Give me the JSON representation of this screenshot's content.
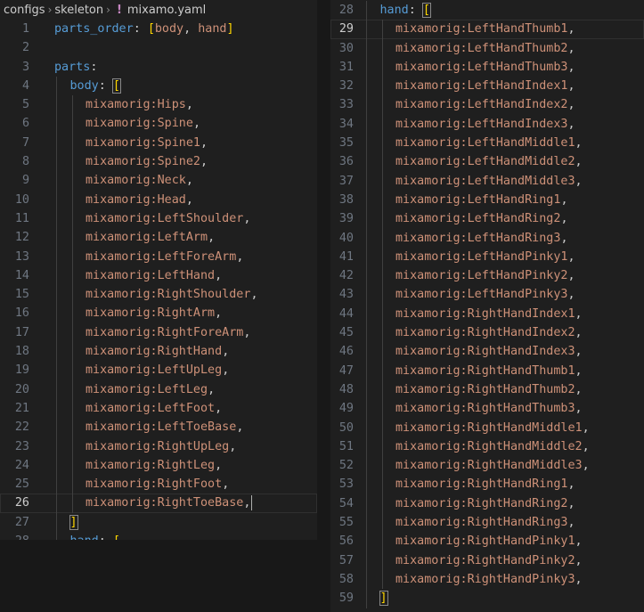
{
  "breadcrumb": {
    "folder1": "configs",
    "folder2": "skeleton",
    "file": "mixamo.yaml",
    "sep": "›",
    "file_icon": "!"
  },
  "left": {
    "active_line": "26",
    "lines": [
      {
        "n": "1",
        "ind": 0,
        "segs": [
          {
            "c": "k",
            "t": "parts_order"
          },
          {
            "c": "p",
            "t": ": "
          },
          {
            "c": "b",
            "t": "["
          },
          {
            "c": "s",
            "t": "body"
          },
          {
            "c": "p",
            "t": ", "
          },
          {
            "c": "s",
            "t": "hand"
          },
          {
            "c": "b",
            "t": "]"
          }
        ]
      },
      {
        "n": "2",
        "ind": 0,
        "segs": []
      },
      {
        "n": "3",
        "ind": 0,
        "segs": [
          {
            "c": "k",
            "t": "parts"
          },
          {
            "c": "p",
            "t": ":"
          }
        ]
      },
      {
        "n": "4",
        "ind": 1,
        "segs": [
          {
            "c": "k",
            "t": "body"
          },
          {
            "c": "p",
            "t": ": "
          },
          {
            "c": "b bb",
            "t": "["
          }
        ]
      },
      {
        "n": "5",
        "ind": 2,
        "segs": [
          {
            "c": "s",
            "t": "mixamorig:Hips"
          },
          {
            "c": "p",
            "t": ","
          }
        ]
      },
      {
        "n": "6",
        "ind": 2,
        "segs": [
          {
            "c": "s",
            "t": "mixamorig:Spine"
          },
          {
            "c": "p",
            "t": ","
          }
        ]
      },
      {
        "n": "7",
        "ind": 2,
        "segs": [
          {
            "c": "s",
            "t": "mixamorig:Spine1"
          },
          {
            "c": "p",
            "t": ","
          }
        ]
      },
      {
        "n": "8",
        "ind": 2,
        "segs": [
          {
            "c": "s",
            "t": "mixamorig:Spine2"
          },
          {
            "c": "p",
            "t": ","
          }
        ]
      },
      {
        "n": "9",
        "ind": 2,
        "segs": [
          {
            "c": "s",
            "t": "mixamorig:Neck"
          },
          {
            "c": "p",
            "t": ","
          }
        ]
      },
      {
        "n": "10",
        "ind": 2,
        "segs": [
          {
            "c": "s",
            "t": "mixamorig:Head"
          },
          {
            "c": "p",
            "t": ","
          }
        ]
      },
      {
        "n": "11",
        "ind": 2,
        "segs": [
          {
            "c": "s",
            "t": "mixamorig:LeftShoulder"
          },
          {
            "c": "p",
            "t": ","
          }
        ]
      },
      {
        "n": "12",
        "ind": 2,
        "segs": [
          {
            "c": "s",
            "t": "mixamorig:LeftArm"
          },
          {
            "c": "p",
            "t": ","
          }
        ]
      },
      {
        "n": "13",
        "ind": 2,
        "segs": [
          {
            "c": "s",
            "t": "mixamorig:LeftForeArm"
          },
          {
            "c": "p",
            "t": ","
          }
        ]
      },
      {
        "n": "14",
        "ind": 2,
        "segs": [
          {
            "c": "s",
            "t": "mixamorig:LeftHand"
          },
          {
            "c": "p",
            "t": ","
          }
        ]
      },
      {
        "n": "15",
        "ind": 2,
        "segs": [
          {
            "c": "s",
            "t": "mixamorig:RightShoulder"
          },
          {
            "c": "p",
            "t": ","
          }
        ]
      },
      {
        "n": "16",
        "ind": 2,
        "segs": [
          {
            "c": "s",
            "t": "mixamorig:RightArm"
          },
          {
            "c": "p",
            "t": ","
          }
        ]
      },
      {
        "n": "17",
        "ind": 2,
        "segs": [
          {
            "c": "s",
            "t": "mixamorig:RightForeArm"
          },
          {
            "c": "p",
            "t": ","
          }
        ]
      },
      {
        "n": "18",
        "ind": 2,
        "segs": [
          {
            "c": "s",
            "t": "mixamorig:RightHand"
          },
          {
            "c": "p",
            "t": ","
          }
        ]
      },
      {
        "n": "19",
        "ind": 2,
        "segs": [
          {
            "c": "s",
            "t": "mixamorig:LeftUpLeg"
          },
          {
            "c": "p",
            "t": ","
          }
        ]
      },
      {
        "n": "20",
        "ind": 2,
        "segs": [
          {
            "c": "s",
            "t": "mixamorig:LeftLeg"
          },
          {
            "c": "p",
            "t": ","
          }
        ]
      },
      {
        "n": "21",
        "ind": 2,
        "segs": [
          {
            "c": "s",
            "t": "mixamorig:LeftFoot"
          },
          {
            "c": "p",
            "t": ","
          }
        ]
      },
      {
        "n": "22",
        "ind": 2,
        "segs": [
          {
            "c": "s",
            "t": "mixamorig:LeftToeBase"
          },
          {
            "c": "p",
            "t": ","
          }
        ]
      },
      {
        "n": "23",
        "ind": 2,
        "segs": [
          {
            "c": "s",
            "t": "mixamorig:RightUpLeg"
          },
          {
            "c": "p",
            "t": ","
          }
        ]
      },
      {
        "n": "24",
        "ind": 2,
        "segs": [
          {
            "c": "s",
            "t": "mixamorig:RightLeg"
          },
          {
            "c": "p",
            "t": ","
          }
        ]
      },
      {
        "n": "25",
        "ind": 2,
        "segs": [
          {
            "c": "s",
            "t": "mixamorig:RightFoot"
          },
          {
            "c": "p",
            "t": ","
          }
        ]
      },
      {
        "n": "26",
        "ind": 2,
        "segs": [
          {
            "c": "s",
            "t": "mixamorig:RightToeBase"
          },
          {
            "c": "p",
            "t": ","
          }
        ],
        "cursor": true
      },
      {
        "n": "27",
        "ind": 1,
        "segs": [
          {
            "c": "b bb",
            "t": "]"
          }
        ]
      },
      {
        "n": "28",
        "ind": 1,
        "segs": [
          {
            "c": "k",
            "t": "hand"
          },
          {
            "c": "p",
            "t": ": "
          },
          {
            "c": "b",
            "t": "["
          }
        ]
      }
    ]
  },
  "right": {
    "active_line": "29",
    "lines": [
      {
        "n": "28",
        "ind": 1,
        "segs": [
          {
            "c": "k",
            "t": "hand"
          },
          {
            "c": "p",
            "t": ": "
          },
          {
            "c": "b bb",
            "t": "["
          }
        ]
      },
      {
        "n": "29",
        "ind": 2,
        "segs": [
          {
            "c": "s",
            "t": "mixamorig:LeftHandThumb1"
          },
          {
            "c": "p",
            "t": ","
          }
        ]
      },
      {
        "n": "30",
        "ind": 2,
        "segs": [
          {
            "c": "s",
            "t": "mixamorig:LeftHandThumb2"
          },
          {
            "c": "p",
            "t": ","
          }
        ]
      },
      {
        "n": "31",
        "ind": 2,
        "segs": [
          {
            "c": "s",
            "t": "mixamorig:LeftHandThumb3"
          },
          {
            "c": "p",
            "t": ","
          }
        ]
      },
      {
        "n": "32",
        "ind": 2,
        "segs": [
          {
            "c": "s",
            "t": "mixamorig:LeftHandIndex1"
          },
          {
            "c": "p",
            "t": ","
          }
        ]
      },
      {
        "n": "33",
        "ind": 2,
        "segs": [
          {
            "c": "s",
            "t": "mixamorig:LeftHandIndex2"
          },
          {
            "c": "p",
            "t": ","
          }
        ]
      },
      {
        "n": "34",
        "ind": 2,
        "segs": [
          {
            "c": "s",
            "t": "mixamorig:LeftHandIndex3"
          },
          {
            "c": "p",
            "t": ","
          }
        ]
      },
      {
        "n": "35",
        "ind": 2,
        "segs": [
          {
            "c": "s",
            "t": "mixamorig:LeftHandMiddle1"
          },
          {
            "c": "p",
            "t": ","
          }
        ]
      },
      {
        "n": "36",
        "ind": 2,
        "segs": [
          {
            "c": "s",
            "t": "mixamorig:LeftHandMiddle2"
          },
          {
            "c": "p",
            "t": ","
          }
        ]
      },
      {
        "n": "37",
        "ind": 2,
        "segs": [
          {
            "c": "s",
            "t": "mixamorig:LeftHandMiddle3"
          },
          {
            "c": "p",
            "t": ","
          }
        ]
      },
      {
        "n": "38",
        "ind": 2,
        "segs": [
          {
            "c": "s",
            "t": "mixamorig:LeftHandRing1"
          },
          {
            "c": "p",
            "t": ","
          }
        ]
      },
      {
        "n": "39",
        "ind": 2,
        "segs": [
          {
            "c": "s",
            "t": "mixamorig:LeftHandRing2"
          },
          {
            "c": "p",
            "t": ","
          }
        ]
      },
      {
        "n": "40",
        "ind": 2,
        "segs": [
          {
            "c": "s",
            "t": "mixamorig:LeftHandRing3"
          },
          {
            "c": "p",
            "t": ","
          }
        ]
      },
      {
        "n": "41",
        "ind": 2,
        "segs": [
          {
            "c": "s",
            "t": "mixamorig:LeftHandPinky1"
          },
          {
            "c": "p",
            "t": ","
          }
        ]
      },
      {
        "n": "42",
        "ind": 2,
        "segs": [
          {
            "c": "s",
            "t": "mixamorig:LeftHandPinky2"
          },
          {
            "c": "p",
            "t": ","
          }
        ]
      },
      {
        "n": "43",
        "ind": 2,
        "segs": [
          {
            "c": "s",
            "t": "mixamorig:LeftHandPinky3"
          },
          {
            "c": "p",
            "t": ","
          }
        ]
      },
      {
        "n": "44",
        "ind": 2,
        "segs": [
          {
            "c": "s",
            "t": "mixamorig:RightHandIndex1"
          },
          {
            "c": "p",
            "t": ","
          }
        ]
      },
      {
        "n": "45",
        "ind": 2,
        "segs": [
          {
            "c": "s",
            "t": "mixamorig:RightHandIndex2"
          },
          {
            "c": "p",
            "t": ","
          }
        ]
      },
      {
        "n": "46",
        "ind": 2,
        "segs": [
          {
            "c": "s",
            "t": "mixamorig:RightHandIndex3"
          },
          {
            "c": "p",
            "t": ","
          }
        ]
      },
      {
        "n": "47",
        "ind": 2,
        "segs": [
          {
            "c": "s",
            "t": "mixamorig:RightHandThumb1"
          },
          {
            "c": "p",
            "t": ","
          }
        ]
      },
      {
        "n": "48",
        "ind": 2,
        "segs": [
          {
            "c": "s",
            "t": "mixamorig:RightHandThumb2"
          },
          {
            "c": "p",
            "t": ","
          }
        ]
      },
      {
        "n": "49",
        "ind": 2,
        "segs": [
          {
            "c": "s",
            "t": "mixamorig:RightHandThumb3"
          },
          {
            "c": "p",
            "t": ","
          }
        ]
      },
      {
        "n": "50",
        "ind": 2,
        "segs": [
          {
            "c": "s",
            "t": "mixamorig:RightHandMiddle1"
          },
          {
            "c": "p",
            "t": ","
          }
        ]
      },
      {
        "n": "51",
        "ind": 2,
        "segs": [
          {
            "c": "s",
            "t": "mixamorig:RightHandMiddle2"
          },
          {
            "c": "p",
            "t": ","
          }
        ]
      },
      {
        "n": "52",
        "ind": 2,
        "segs": [
          {
            "c": "s",
            "t": "mixamorig:RightHandMiddle3"
          },
          {
            "c": "p",
            "t": ","
          }
        ]
      },
      {
        "n": "53",
        "ind": 2,
        "segs": [
          {
            "c": "s",
            "t": "mixamorig:RightHandRing1"
          },
          {
            "c": "p",
            "t": ","
          }
        ]
      },
      {
        "n": "54",
        "ind": 2,
        "segs": [
          {
            "c": "s",
            "t": "mixamorig:RightHandRing2"
          },
          {
            "c": "p",
            "t": ","
          }
        ]
      },
      {
        "n": "55",
        "ind": 2,
        "segs": [
          {
            "c": "s",
            "t": "mixamorig:RightHandRing3"
          },
          {
            "c": "p",
            "t": ","
          }
        ]
      },
      {
        "n": "56",
        "ind": 2,
        "segs": [
          {
            "c": "s",
            "t": "mixamorig:RightHandPinky1"
          },
          {
            "c": "p",
            "t": ","
          }
        ]
      },
      {
        "n": "57",
        "ind": 2,
        "segs": [
          {
            "c": "s",
            "t": "mixamorig:RightHandPinky2"
          },
          {
            "c": "p",
            "t": ","
          }
        ]
      },
      {
        "n": "58",
        "ind": 2,
        "segs": [
          {
            "c": "s",
            "t": "mixamorig:RightHandPinky3"
          },
          {
            "c": "p",
            "t": ","
          }
        ]
      },
      {
        "n": "59",
        "ind": 1,
        "segs": [
          {
            "c": "b bb",
            "t": "]"
          }
        ]
      }
    ]
  }
}
